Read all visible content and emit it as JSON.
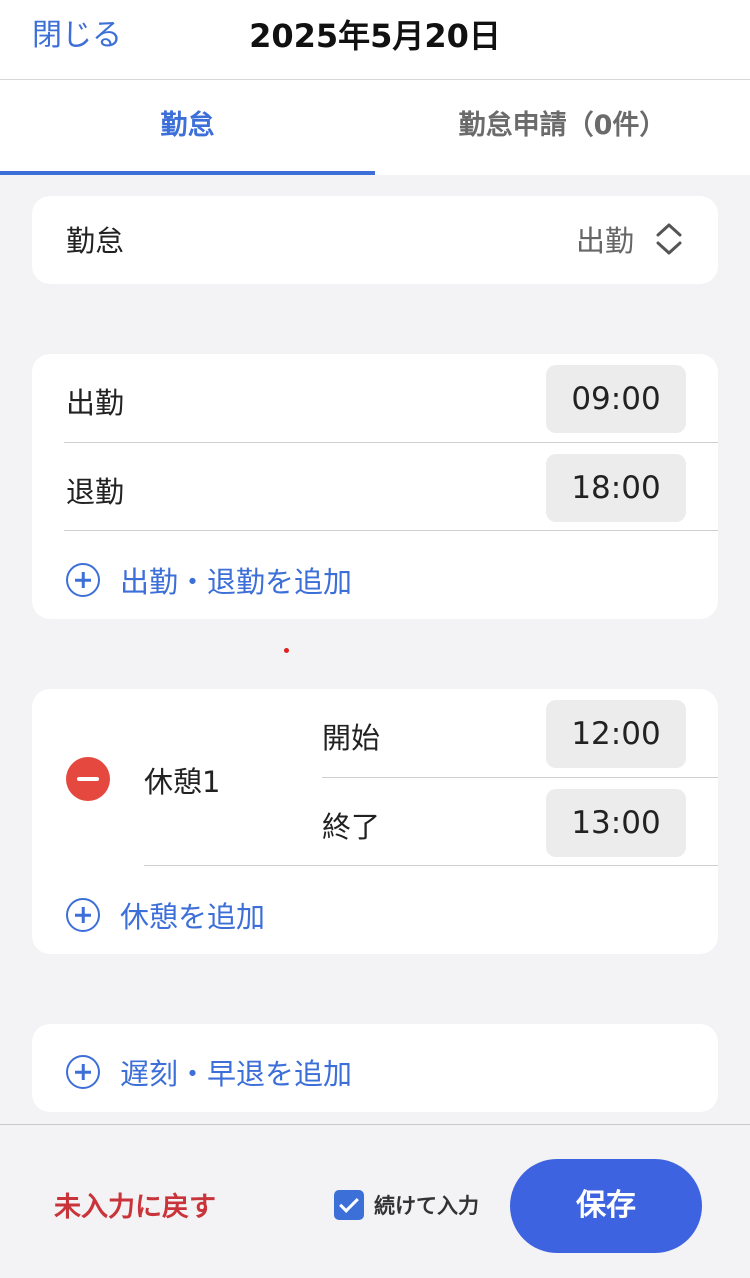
{
  "header": {
    "close_label": "閉じる",
    "title": "2025年5月20日"
  },
  "tabs": [
    {
      "label": "勤怠",
      "active": true
    },
    {
      "label": "勤怠申請（0件）",
      "active": false
    }
  ],
  "attendance_type": {
    "label": "勤怠",
    "value": "出勤"
  },
  "clock_card": {
    "rows": [
      {
        "label": "出勤",
        "time": "09:00"
      },
      {
        "label": "退勤",
        "time": "18:00"
      }
    ],
    "add_label": "出勤・退勤を追加"
  },
  "break_card": {
    "break_label": "休憩1",
    "rows": [
      {
        "label": "開始",
        "time": "12:00"
      },
      {
        "label": "終了",
        "time": "13:00"
      }
    ],
    "add_label": "休憩を追加"
  },
  "late_card": {
    "add_label": "遅刻・早退を追加"
  },
  "footer": {
    "revert_label": "未入力に戻す",
    "continue_label": "続けて入力",
    "continue_checked": true,
    "save_label": "保存"
  },
  "colors": {
    "accent": "#3d6fd8",
    "danger": "#e5483e",
    "revert_text": "#c9343b",
    "save_button": "#3d63e0"
  }
}
